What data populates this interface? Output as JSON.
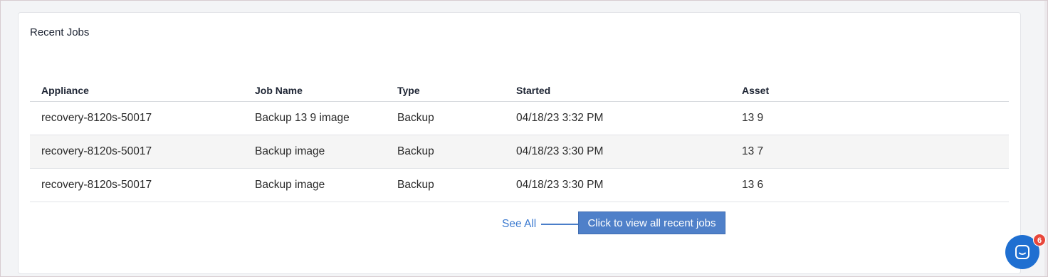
{
  "card": {
    "title": "Recent Jobs"
  },
  "table": {
    "columns": [
      "Appliance",
      "Job Name",
      "Type",
      "Started",
      "Asset"
    ],
    "rows": [
      {
        "appliance": "recovery-8120s-50017",
        "job_name": "Backup 13  9 image",
        "type": "Backup",
        "started": "04/18/23 3:32 PM",
        "asset": "13  9"
      },
      {
        "appliance": "recovery-8120s-50017",
        "job_name": "Backup image",
        "type": "Backup",
        "started": "04/18/23 3:30 PM",
        "asset": "13  7"
      },
      {
        "appliance": "recovery-8120s-50017",
        "job_name": "Backup image",
        "type": "Backup",
        "started": "04/18/23 3:30 PM",
        "asset": "13  6"
      }
    ]
  },
  "footer": {
    "see_all_label": "See All",
    "callout_text": "Click to view all recent jobs"
  },
  "chat": {
    "icon": "chat-bubble-icon",
    "badge_count": "6"
  },
  "colors": {
    "link": "#3d7bd0",
    "callout_bg": "#4f80c9",
    "chat_bg": "#1f6fd1",
    "badge_bg": "#e8473b",
    "alt_row": "#f5f5f5"
  }
}
